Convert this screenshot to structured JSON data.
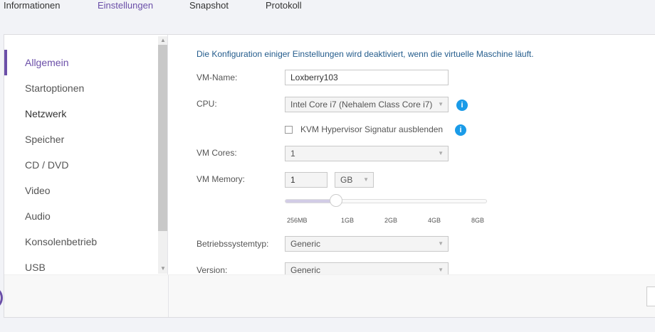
{
  "tabs": [
    {
      "label": "Informationen"
    },
    {
      "label": "Einstellungen"
    },
    {
      "label": "Snapshot"
    },
    {
      "label": "Protokoll"
    }
  ],
  "sidebar": {
    "items": [
      {
        "label": "Allgemein"
      },
      {
        "label": "Startoptionen"
      },
      {
        "label": "Netzwerk"
      },
      {
        "label": "Speicher"
      },
      {
        "label": "CD / DVD"
      },
      {
        "label": "Video"
      },
      {
        "label": "Audio"
      },
      {
        "label": "Konsolenbetrieb"
      },
      {
        "label": "USB"
      }
    ]
  },
  "form": {
    "note": "Die Konfiguration einiger Einstellungen wird deaktiviert, wenn die virtuelle Maschine läuft.",
    "vm_name_label": "VM-Name:",
    "vm_name_value": "Loxberry103",
    "cpu_label": "CPU:",
    "cpu_value": "Intel Core i7 (Nehalem Class Core i7)",
    "kvm_label": "KVM Hypervisor Signatur ausblenden",
    "kvm_checked": false,
    "info_glyph": "i",
    "cores_label": "VM Cores:",
    "cores_value": "1",
    "memory_label": "VM Memory:",
    "memory_value": "1",
    "memory_unit": "GB",
    "memory_slider_percent": 25,
    "memory_ticks": [
      "256MB",
      "1GB",
      "2GB",
      "4GB",
      "8GB"
    ],
    "os_label": "Betriebssystemtyp:",
    "os_value": "Generic",
    "version_label": "Version:",
    "version_value": "Generic"
  },
  "colors": {
    "accent": "#6b4fa8",
    "info": "#1a9be8",
    "note": "#245c8c"
  }
}
